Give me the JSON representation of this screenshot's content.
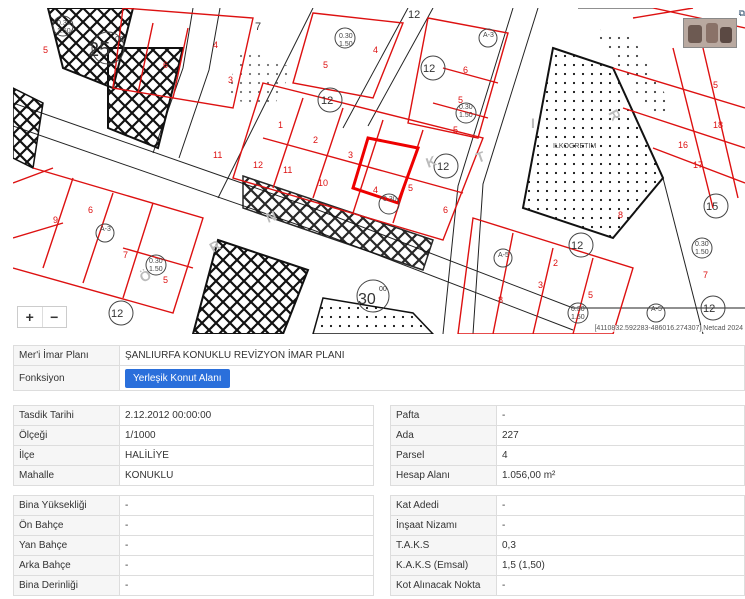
{
  "map": {
    "coordinates": "[4110832.592283-486016.274307] Netcad 2024",
    "zoom_in": "+",
    "zoom_out": "−",
    "corner_icon": "layers-icon",
    "labels": {
      "block25": "25",
      "block25_sup": "00",
      "block30": "30",
      "block30_sup": "00",
      "block12a": "12",
      "block12b": "12",
      "block12c": "12",
      "block12d": "12",
      "block12e": "12",
      "block12f": "12",
      "block15": "15",
      "school": "İLKOĞRETİM"
    }
  },
  "plan": {
    "plan_label": "Mer'i İmar Planı",
    "plan_value": "ŞANLIURFA KONUKLU REVİZYON İMAR PLANI",
    "function_label": "Fonksiyon",
    "function_button": "Yerleşik Konut Alanı"
  },
  "left1": [
    {
      "label": "Tasdik Tarihi",
      "value": "2.12.2012 00:00:00"
    },
    {
      "label": "Ölçeği",
      "value": "1/1000"
    },
    {
      "label": "İlçe",
      "value": "HALİLİYE"
    },
    {
      "label": "Mahalle",
      "value": "KONUKLU"
    }
  ],
  "right1": [
    {
      "label": "Pafta",
      "value": "-"
    },
    {
      "label": "Ada",
      "value": "227"
    },
    {
      "label": "Parsel",
      "value": "4"
    },
    {
      "label": "Hesap Alanı",
      "value": "1.056,00 m²"
    }
  ],
  "left2": [
    {
      "label": "Bina Yüksekliği",
      "value": "-"
    },
    {
      "label": "Ön Bahçe",
      "value": "-"
    },
    {
      "label": "Yan Bahçe",
      "value": "-"
    },
    {
      "label": "Arka Bahçe",
      "value": "-"
    },
    {
      "label": "Bina Derinliği",
      "value": "-"
    }
  ],
  "right2": [
    {
      "label": "Kat Adedi",
      "value": "-"
    },
    {
      "label": "İnşaat Nizamı",
      "value": "-"
    },
    {
      "label": "T.A.K.S",
      "value": "0,3"
    },
    {
      "label": "K.A.K.S (Emsal)",
      "value": "1,5 (1,50)"
    },
    {
      "label": "Kot Alınacak Nokta",
      "value": "-"
    }
  ]
}
